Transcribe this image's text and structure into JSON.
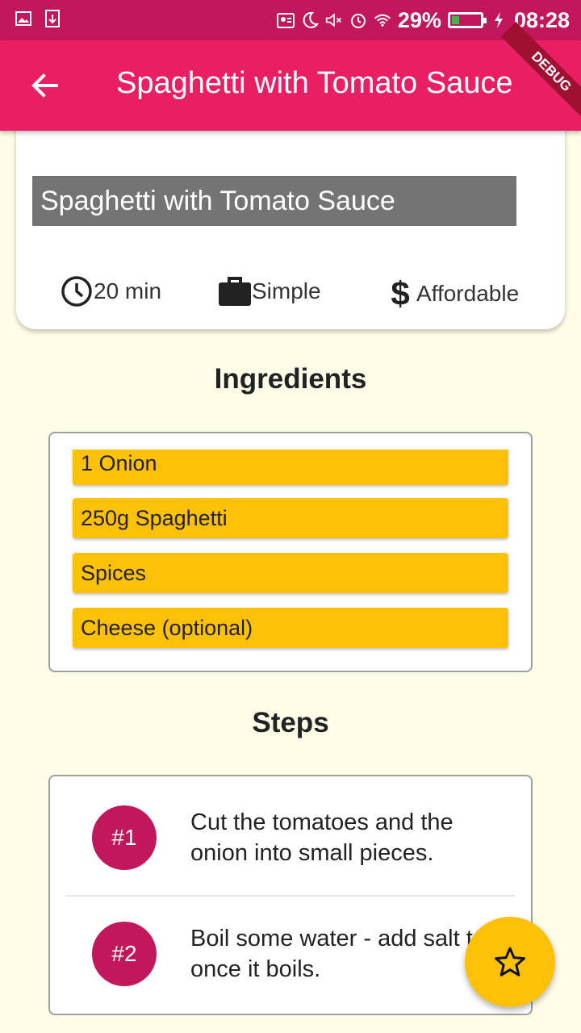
{
  "status_bar": {
    "battery": "29%",
    "time": "08:28",
    "icons": [
      "gallery-icon",
      "usb-icon",
      "contact-card-icon",
      "moon-icon",
      "mute-icon",
      "alarm-icon",
      "wifi-icon",
      "battery-icon",
      "charging-icon"
    ]
  },
  "app_bar": {
    "title": "Spaghetti with Tomato Sauce",
    "back_icon": "arrow-back-icon",
    "debug_banner": "DEBUG"
  },
  "meal": {
    "image_title": "Spaghetti with Tomato Sauce",
    "duration": "20 min",
    "complexity": "Simple",
    "affordability": "Affordable"
  },
  "ingredients": {
    "title": "Ingredients",
    "items": [
      "1 Onion",
      "250g Spaghetti",
      "Spices",
      "Cheese (optional)"
    ]
  },
  "steps": {
    "title": "Steps",
    "items": [
      {
        "number": "#1",
        "text": "Cut the tomatoes and the onion into small pieces."
      },
      {
        "number": "#2",
        "text": "Boil some water - add salt to it once it boils."
      }
    ]
  },
  "fab": {
    "icon": "star-outline-icon"
  },
  "colors": {
    "primary": "#E91E63",
    "primary_dark": "#C2185B",
    "accent": "#FFC107",
    "background": "#FFFDE7"
  }
}
